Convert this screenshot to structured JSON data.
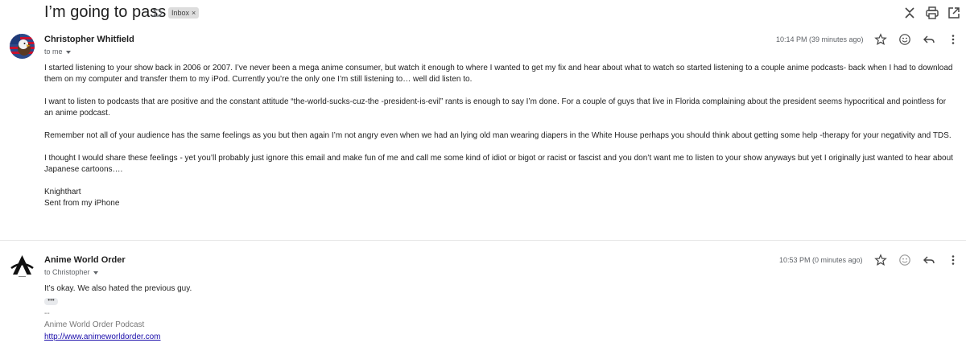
{
  "thread": {
    "subject": "I’m going to pass",
    "label_chip": "Inbox",
    "label_close": "×",
    "actions": [
      "collapse-icon",
      "print-icon",
      "open-new-window-icon"
    ]
  },
  "messages": [
    {
      "sender": "Christopher Whitfield",
      "recipient_line": "to me",
      "time": "10:14 PM (39 minutes ago)",
      "avatar": "eagle-flag-avatar",
      "paragraphs": [
        "I started listening to your show back in 2006 or 2007. I’ve never been a mega anime consumer, but watch it enough to where I wanted to get my fix and hear about what to watch so started listening to a couple anime podcasts- back when I had to download them on my computer and transfer them to my iPod. Currently you’re the only one I’m still listening to… well did listen to.",
        "I want to listen to podcasts that are positive and the constant attitude “the-world-sucks-cuz-the -president-is-evil” rants is enough to say I’m done. For a couple of guys that live in Florida complaining about the president seems hypocritical and pointless for an anime podcast.",
        "Remember not all of your audience has the same feelings as you but then again I’m not angry even when we had an lying old man wearing diapers in the White House perhaps you should think about getting some help -therapy for your negativity and TDS.",
        "I thought I would share these feelings - yet you’ll probably just ignore this email and make fun of me and call me some kind of idiot or bigot or racist or fascist and you don’t want me to listen to your show anyways but yet I originally just wanted to hear about Japanese cartoons…."
      ],
      "signoff_name": "Knighthart",
      "signoff_device": "Sent from my iPhone"
    },
    {
      "sender": "Anime World Order",
      "recipient_line": "to Christopher",
      "time": "10:53 PM (0 minutes ago)",
      "avatar": "awo-logo-avatar",
      "paragraphs": [
        "It’s okay. We also hated the previous guy."
      ],
      "ellipsis": "•••",
      "sig_separator": "--",
      "sig_name": "Anime World Order Podcast",
      "sig_link": "http://www.animeworldorder.com"
    }
  ],
  "colors": {
    "link": "#1a0dab",
    "chip_bg": "#dddddd",
    "muted": "#5f6368"
  }
}
